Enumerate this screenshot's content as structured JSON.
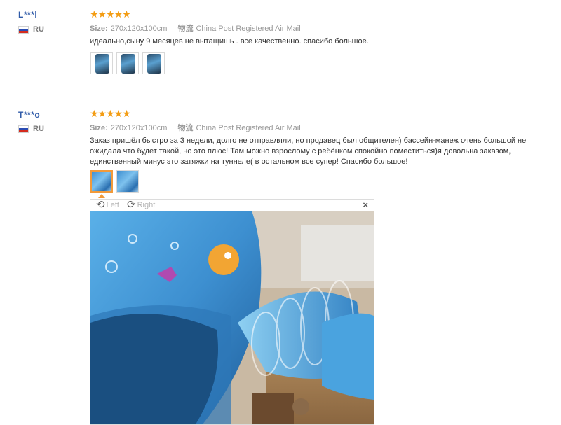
{
  "reviews": [
    {
      "user": "L***l",
      "country": "RU",
      "stars": "★★★★★",
      "size_label": "Size:",
      "size_value": "270x120x100cm",
      "ship_label": "物流",
      "ship_value": "China Post Registered Air Mail",
      "text": "идеально,сыну 9 месяцев не вытащишь . все качественно. спасибо большое."
    },
    {
      "user": "T***o",
      "country": "RU",
      "stars": "★★★★★",
      "size_label": "Size:",
      "size_value": "270x120x100cm",
      "ship_label": "物流",
      "ship_value": "China Post Registered Air Mail",
      "text": "Заказ пришёл быстро за 3 недели, долго не отправляли, но продавец был общителен) бассейн-манеж очень большой не ожидала что будет такой, но это плюс! Там можно взрослому с ребёнком спокойно поместиться)я довольна заказом, единственный минус это затяжки на туннеле( в остальном все супер! Спасибо большое!"
    }
  ],
  "viewer": {
    "rotate_left_label": "Left",
    "rotate_right_label": "Right",
    "close_glyph": "×",
    "rotate_left_icon": "rotate-left-icon",
    "rotate_right_icon": "rotate-right-icon"
  },
  "colors": {
    "star": "#f39c12",
    "username": "#2f5aa8",
    "selected_thumb": "#f29a3a"
  }
}
